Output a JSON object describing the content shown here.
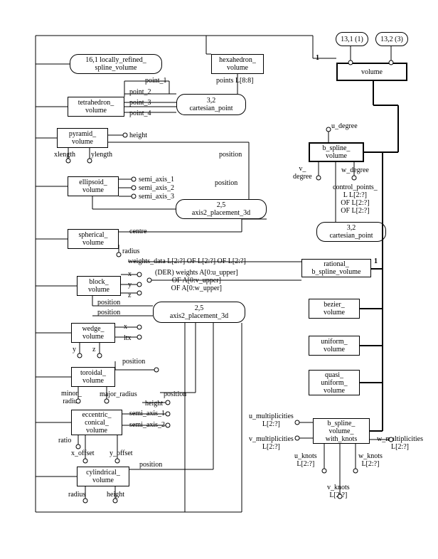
{
  "header": {
    "ref1": "13,1 (1)",
    "ref3": "13,2 (3)"
  },
  "entities": {
    "locallyRefinedSplineVolume": "16,1 locally_refined_\nspline_volume",
    "hexahedronVolume": "hexahedron_\nvolume",
    "volume": "volume",
    "tetrahedronVolume": "tetrahedron_\nvolume",
    "cartesianPoint32a": "3,2\ncartesian_point",
    "pyramidVolume": "pyramid_\nvolume",
    "bSplineVolume": "b_spline_\nvolume",
    "ellipsoidVolume": "ellipsoid_\nvolume",
    "axis2Placement3d_a": "2,5\naxis2_placement_3d",
    "cartesianPoint32b": "3,2\ncartesian_point",
    "sphericalVolume": "spherical_\nvolume",
    "rationalBSplineVolume": "rational_\nb_spline_volume",
    "blockVolume": "block_\nvolume",
    "axis2Placement3d_b": "2,5\naxis2_placement_3d",
    "bezierVolume": "bezier_\nvolume",
    "wedgeVolume": "wedge_\nvolume",
    "uniformVolume": "uniform_\nvolume",
    "toroidalVolume": "toroidal_\nvolume",
    "quasiUniformVolume": "quasi_\nuniform_\nvolume",
    "eccentricConicalVolume": "eccentric_\nconical_\nvolume",
    "bSplineVolumeWithKnots": "b_spline_\nvolume_\nwith_knots",
    "cylindricalVolume": "cylindrical_\nvolume"
  },
  "labels": {
    "point1": "point_1",
    "point2": "point_2",
    "point3": "point_3",
    "point4": "point_4",
    "pointsL88": "points L[8:8]",
    "height": "height",
    "xlength": "xlength",
    "ylength": "ylength",
    "position": "position",
    "uDegree": "u_degree",
    "vDegree": "v_\ndegree",
    "wDegree": "w_degree",
    "controlPointsL": "control_points_\nL L[2:?]\nOF L[2:?]\nOF L[2:?]",
    "semiAxis1": "semi_axis_1",
    "semiAxis2": "semi_axis_2",
    "semiAxis3": "semi_axis_3",
    "centre": "centre",
    "radius": "radius",
    "weightsData": "weights_data L[2:?] OF L[2:?] OF L[2:?]",
    "derWeights": "(DER) weights A[0:u_upper]\nOF A[0:v_upper]\nOF A[0:w_upper]",
    "x": "x",
    "y": "y",
    "z": "z",
    "ltx": "ltx",
    "minorRadius": "minor_\nradius",
    "majorRadius": "major_radius",
    "ratio": "ratio",
    "xOffset": "x_offset",
    "yOffset": "y_offset",
    "uMultiplicities": "u_multiplicities\nL[2:?]",
    "vMultiplicities": "v_multiplicities\nL[2:?]",
    "wMultiplicities": "w_multiplicities\nL[2:?]",
    "uKnots": "u_knots\nL[2:?]",
    "vKnots": "v_knots\nL[2:?]",
    "wKnots": "w_knots\nL[2:?]",
    "one": "1"
  }
}
